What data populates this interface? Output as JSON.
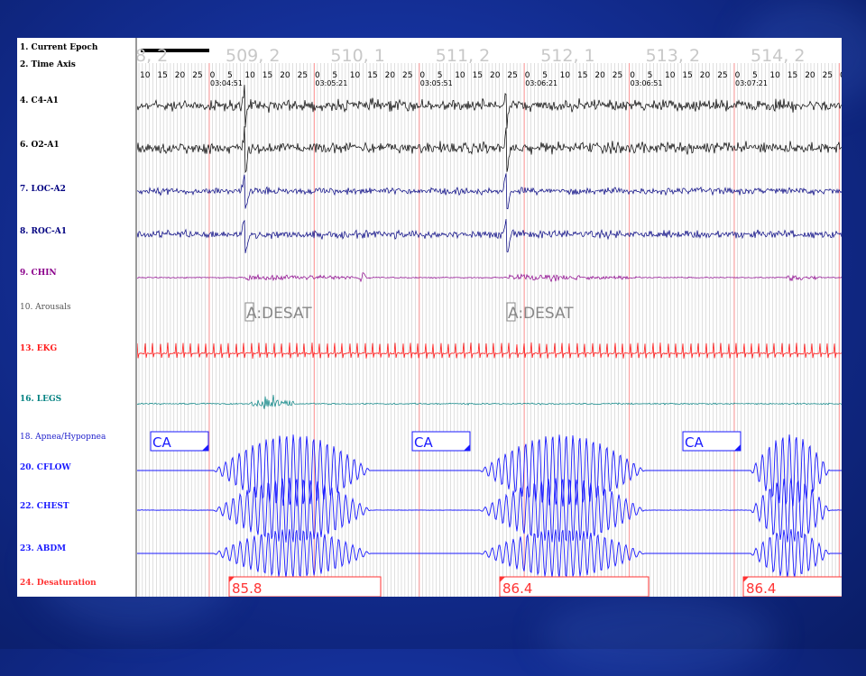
{
  "channels": [
    {
      "key": "epoch",
      "label": "1. Current Epoch",
      "color": "#000000"
    },
    {
      "key": "time",
      "label": "2. Time Axis",
      "color": "#000000"
    },
    {
      "key": "c4a1",
      "label": "4. C4-A1",
      "color": "#000000"
    },
    {
      "key": "o2a1",
      "label": "6. O2-A1",
      "color": "#000000"
    },
    {
      "key": "loca2",
      "label": "7. LOC-A2",
      "color": "#000080"
    },
    {
      "key": "roca1",
      "label": "8. ROC-A1",
      "color": "#000080"
    },
    {
      "key": "chin",
      "label": "9. CHIN",
      "color": "#8b008b"
    },
    {
      "key": "arous",
      "label": "10. Arousals",
      "color": "#555555"
    },
    {
      "key": "ekg",
      "label": "13. EKG",
      "color": "#ff1a1a"
    },
    {
      "key": "legs",
      "label": "16. LEGS",
      "color": "#008080"
    },
    {
      "key": "apnea",
      "label": "18. Apnea/Hypopnea",
      "color": "#2020cc"
    },
    {
      "key": "cflow",
      "label": "20. CFLOW",
      "color": "#1a1aff"
    },
    {
      "key": "chest",
      "label": "22. CHEST",
      "color": "#1a1aff"
    },
    {
      "key": "abdm",
      "label": "23. ABDM",
      "color": "#1a1aff"
    },
    {
      "key": "desat",
      "label": "24. Desaturation",
      "color": "#ff3333"
    }
  ],
  "epochs": [
    "509, 2",
    "510, 1",
    "511, 2",
    "512, 1",
    "513, 2",
    "514, 2"
  ],
  "epoch_first_partial": "8, 2",
  "time_ticks": [
    "10",
    "15",
    "20",
    "25",
    "0",
    "5",
    "10",
    "15",
    "20",
    "25",
    "0",
    "5",
    "10",
    "15",
    "20",
    "25",
    "0",
    "5",
    "10",
    "15",
    "20",
    "25",
    "0",
    "5",
    "10",
    "15",
    "20",
    "25",
    "0",
    "5",
    "10",
    "15",
    "20",
    "25",
    "0",
    "5",
    "10",
    "15",
    "20",
    "25",
    "0"
  ],
  "clock_times": [
    "03:04:51",
    "03:05:21",
    "03:05:51",
    "03:06:21",
    "03:06:51",
    "03:07:21"
  ],
  "arousal_events": [
    "A:DESAT",
    "A:DESAT"
  ],
  "apnea_events": [
    "CA",
    "CA",
    "CA"
  ],
  "desat_values": [
    "85.8",
    "86.4",
    "86.4"
  ],
  "colors": {
    "eeg": "#000000",
    "eog": "#000080",
    "chin": "#8b008b",
    "ekg": "#ff1a1a",
    "legs": "#008080",
    "resp": "#1a1aff",
    "desat": "#ff3333",
    "grid": "#bfbfbf",
    "epoch_line": "#ff9999"
  }
}
